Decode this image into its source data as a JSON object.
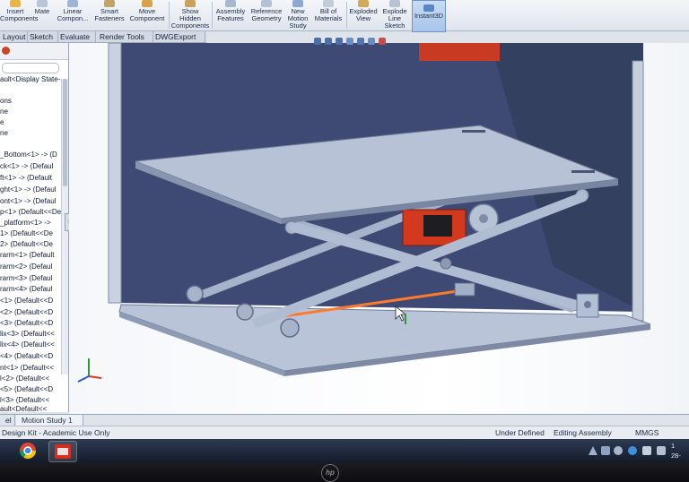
{
  "ribbon": {
    "buttons": [
      {
        "label": "Insert Components"
      },
      {
        "label": "Mate"
      },
      {
        "label": "Linear Compon..."
      },
      {
        "label": "Smart Fasteners"
      },
      {
        "label": "Move Component"
      },
      {
        "label": "Show Hidden Components"
      },
      {
        "label": "Assembly Features"
      },
      {
        "label": "Reference Geometry"
      },
      {
        "label": "New Motion Study"
      },
      {
        "label": "Bill of Materials"
      },
      {
        "label": "Exploded View"
      },
      {
        "label": "Explode Line Sketch"
      },
      {
        "label": "Instant3D"
      }
    ]
  },
  "tabs": [
    {
      "label": "Layout"
    },
    {
      "label": "Sketch"
    },
    {
      "label": "Evaluate"
    },
    {
      "label": "Render Tools"
    },
    {
      "label": "DWGExport"
    }
  ],
  "tree": {
    "items": [
      "ault<Display State-",
      "ons",
      "ne",
      "e",
      "ne",
      "_Bottom<1> -> (D",
      "ck<1> -> (Defaul",
      "ft<1> -> (Default",
      "ght<1> -> (Defaul",
      "ont<1> -> (Defaul",
      "p<1> (Default<<De",
      "_platform<1> ->",
      "1> (Default<<De",
      "2> (Default<<De",
      "rarm<1> (Default",
      "rarm<2> (Defaul",
      "rarm<3> (Defaul",
      "rarm<4> (Defaul",
      "<1> (Default<<D",
      "<2> (Default<<D",
      "<3> (Default<<D",
      "lix<3> (Default<<",
      "lix<4> (Default<<",
      "<4> (Default<<D",
      "nt<1> (Default<<",
      "l<2> (Default<<",
      "<5> (Default<<D",
      "l<3> (Default<<",
      "ault<Default<<"
    ]
  },
  "bottom_tabs": [
    {
      "label": "el"
    },
    {
      "label": "Motion Study 1"
    }
  ],
  "status": {
    "left": "Design Kit - Academic Use Only",
    "defined": "Under Defined",
    "mode": "Editing Assembly",
    "units": "MMGS"
  },
  "clock": {
    "time": "1",
    "date": "28-"
  },
  "bezel": {
    "logo": "hp"
  },
  "colors": {
    "part": "#aebad0",
    "part_dark": "#7f8ca6",
    "background_wall": "#3b4770",
    "motor": "#d2391f",
    "highlight": "#ff7a2e"
  }
}
